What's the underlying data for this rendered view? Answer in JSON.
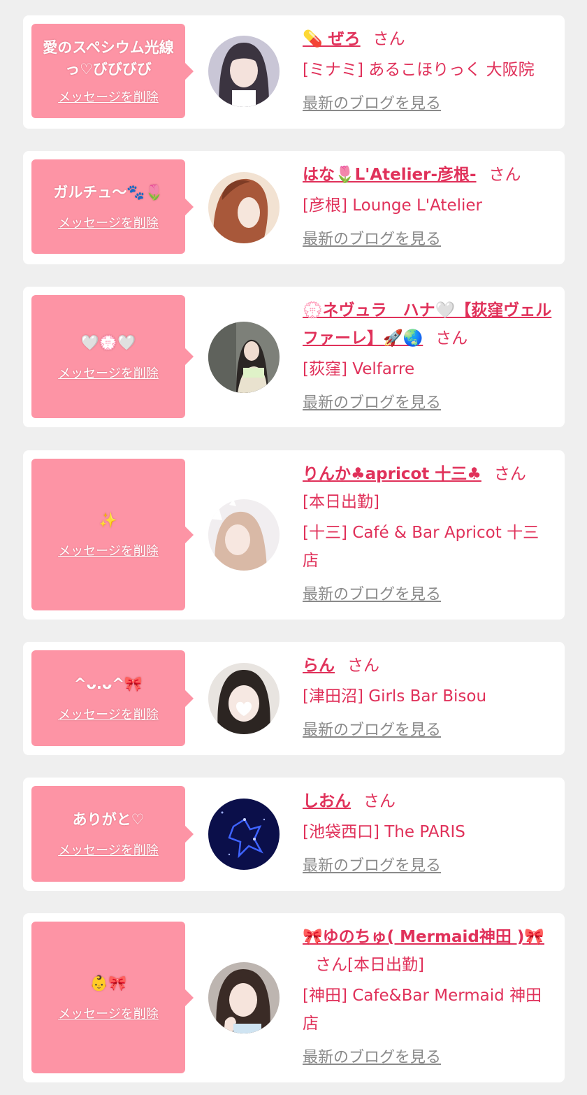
{
  "delete_label": "メッセージを削除",
  "blog_label": "最新のブログを見る",
  "san_label": "さん",
  "cards": [
    {
      "message": "愛のスペシウム光線っ♡びびびび",
      "name": "💊 ぜろ",
      "shift": "",
      "suffix": "",
      "shop": "[ミナミ] あるこほりっく 大阪院",
      "avatar_colors": [
        "#c9c6d6",
        "#3b3440"
      ]
    },
    {
      "message": "ガルチュ〜🐾🌷",
      "name": "はな🌷L'Atelier-彦根-",
      "shift": "",
      "suffix": "",
      "shop": "[彦根] Lounge L'Atelier",
      "avatar_colors": [
        "#f2e2d2",
        "#a8583a"
      ]
    },
    {
      "message": "🤍💮🤍",
      "name": "💮ネヴュラ　ハナ🤍【荻窪ヴェルファーレ】🚀🌏",
      "shift": "",
      "suffix": "",
      "shop": "[荻窪] Velfarre",
      "avatar_colors": [
        "#7d8079",
        "#e9e2cf"
      ]
    },
    {
      "message": "✨",
      "name": "りんか♣apricot 十三♣",
      "shift": "[本日出勤]",
      "suffix": "",
      "shop": "[十三] Café & Bar Apricot 十三店",
      "avatar_colors": [
        "#f1eef0",
        "#d9b9a6"
      ]
    },
    {
      "message": "^ᴗ.ᴗ^🎀",
      "name": "らん",
      "shift": "",
      "suffix": "",
      "shop": "[津田沼] Girls Bar Bisou",
      "avatar_colors": [
        "#e8e4e0",
        "#2c2522"
      ]
    },
    {
      "message": "ありがと♡",
      "name": "しおん",
      "shift": "",
      "suffix": "",
      "shop": "[池袋西口] The PARIS",
      "avatar_colors": [
        "#0b0f4a",
        "#3e63ff"
      ]
    },
    {
      "message": "👶🎀",
      "name": "🎀ゆのちゅ( Mermaid神田 )🎀",
      "shift": "",
      "suffix": "[本日出勤]",
      "shop": "[神田] Cafe&Bar Mermaid 神田店",
      "avatar_colors": [
        "#bdb5b0",
        "#3a2b26"
      ]
    }
  ]
}
